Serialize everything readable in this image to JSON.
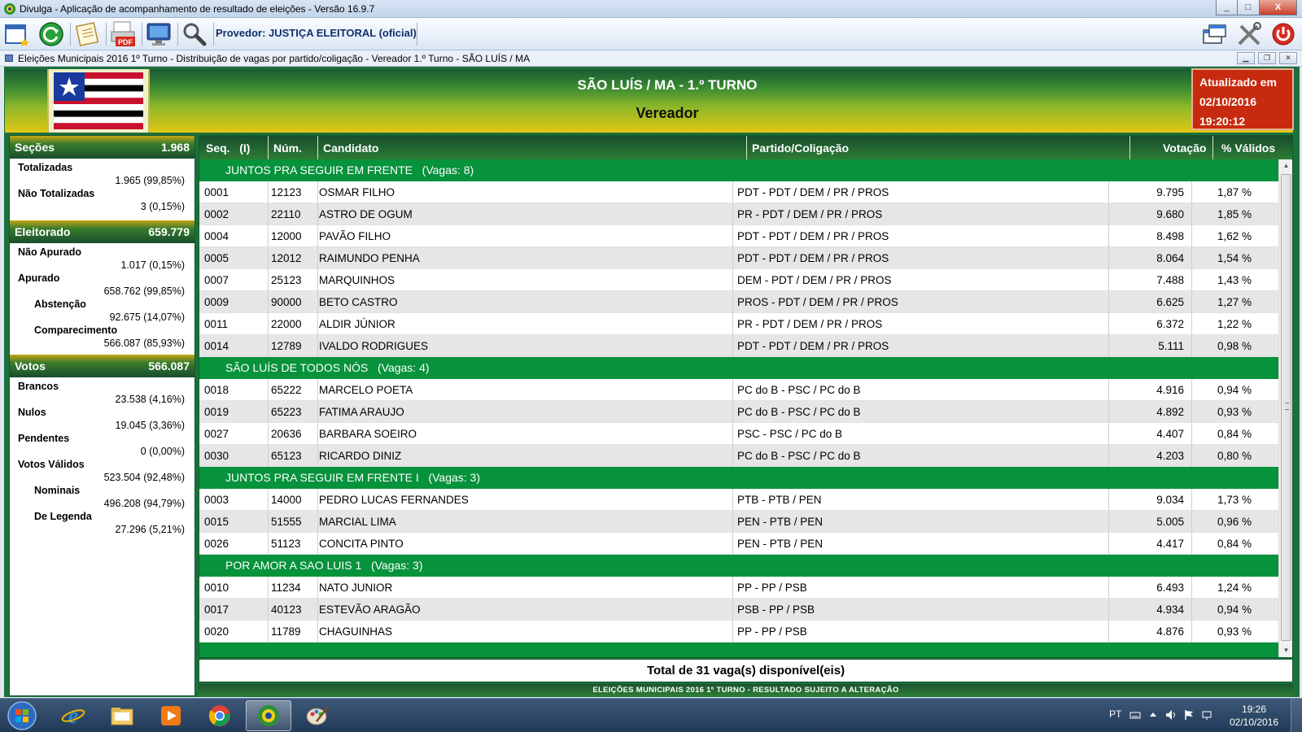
{
  "window": {
    "title": "Divulga - Aplicação de acompanhamento de resultado de eleições - Versão 16.9.7",
    "controls": [
      "_",
      "□",
      "X"
    ]
  },
  "toolbar": {
    "provider_label": "Provedor: JUSTIÇA ELEITORAL (oficial)",
    "buttons": [
      "new-window-icon",
      "refresh-icon",
      "document-icon",
      "pdf-icon",
      "monitor-icon",
      "search-icon"
    ],
    "pdf_label": "PDF"
  },
  "mdi": {
    "title": "Eleições Municipais 2016 1º Turno - Distribuição de vagas por partido/coligação - Vereador 1.º Turno - SÃO LUÍS / MA"
  },
  "header": {
    "title": "SÃO LUÍS / MA - 1.º TURNO",
    "subtitle": "Vereador",
    "updated_label": "Atualizado em",
    "updated_date": "02/10/2016",
    "updated_time": "19:20:12"
  },
  "stats": {
    "secoes": {
      "label": "Seções",
      "value": "1.968"
    },
    "totalizadas": {
      "label": "Totalizadas",
      "value": "1.965 (99,85%)"
    },
    "nao_totalizadas": {
      "label": "Não Totalizadas",
      "value": "3 (0,15%)"
    },
    "eleitorado": {
      "label": "Eleitorado",
      "value": "659.779"
    },
    "nao_apurado": {
      "label": "Não Apurado",
      "value": "1.017 (0,15%)"
    },
    "apurado": {
      "label": "Apurado",
      "value": "658.762 (99,85%)"
    },
    "abstencao": {
      "label": "Abstenção",
      "value": "92.675 (14,07%)"
    },
    "comparecimento": {
      "label": "Comparecimento",
      "value": "566.087 (85,93%)"
    },
    "votos": {
      "label": "Votos",
      "value": "566.087"
    },
    "brancos": {
      "label": "Brancos",
      "value": "23.538 (4,16%)"
    },
    "nulos": {
      "label": "Nulos",
      "value": "19.045 (3,36%)"
    },
    "pendentes": {
      "label": "Pendentes",
      "value": "0 (0,00%)"
    },
    "validos": {
      "label": "Votos Válidos",
      "value": "523.504 (92,48%)"
    },
    "nominais": {
      "label": "Nominais",
      "value": "496.208 (94,79%)"
    },
    "legenda": {
      "label": "De Legenda",
      "value": "27.296 (5,21%)"
    }
  },
  "table": {
    "columns": {
      "seq": "Seq.",
      "seq_suffix": "(I)",
      "num": "Núm.",
      "cand": "Candidato",
      "party": "Partido/Coligação",
      "votes": "Votação",
      "pct": "% Válidos"
    },
    "groups": [
      {
        "label": "JUNTOS PRA SEGUIR EM FRENTE   (Vagas: 8)",
        "rows": [
          [
            "0001",
            "12123",
            "OSMAR FILHO",
            "PDT - PDT / DEM / PR / PROS",
            "9.795",
            "1,87 %"
          ],
          [
            "0002",
            "22110",
            "ASTRO DE OGUM",
            "PR - PDT / DEM / PR / PROS",
            "9.680",
            "1,85 %"
          ],
          [
            "0004",
            "12000",
            "PAVÃO FILHO",
            "PDT - PDT / DEM / PR / PROS",
            "8.498",
            "1,62 %"
          ],
          [
            "0005",
            "12012",
            "RAIMUNDO PENHA",
            "PDT - PDT / DEM / PR / PROS",
            "8.064",
            "1,54 %"
          ],
          [
            "0007",
            "25123",
            "MARQUINHOS",
            "DEM - PDT / DEM / PR / PROS",
            "7.488",
            "1,43 %"
          ],
          [
            "0009",
            "90000",
            "BETO CASTRO",
            "PROS - PDT / DEM / PR / PROS",
            "6.625",
            "1,27 %"
          ],
          [
            "0011",
            "22000",
            "ALDIR JÚNIOR",
            "PR - PDT / DEM / PR / PROS",
            "6.372",
            "1,22 %"
          ],
          [
            "0014",
            "12789",
            "IVALDO RODRIGUES",
            "PDT - PDT / DEM / PR / PROS",
            "5.111",
            "0,98 %"
          ]
        ]
      },
      {
        "label": "SÃO LUÍS DE TODOS NÓS   (Vagas: 4)",
        "rows": [
          [
            "0018",
            "65222",
            "MARCELO POETA",
            "PC do B - PSC / PC do B",
            "4.916",
            "0,94 %"
          ],
          [
            "0019",
            "65223",
            "FATIMA ARAUJO",
            "PC do B - PSC / PC do B",
            "4.892",
            "0,93 %"
          ],
          [
            "0027",
            "20636",
            "BARBARA SOEIRO",
            "PSC - PSC / PC do B",
            "4.407",
            "0,84 %"
          ],
          [
            "0030",
            "65123",
            "RICARDO DINIZ",
            "PC do B - PSC / PC do B",
            "4.203",
            "0,80 %"
          ]
        ]
      },
      {
        "label": "JUNTOS PRA SEGUIR EM FRENTE I   (Vagas: 3)",
        "rows": [
          [
            "0003",
            "14000",
            "PEDRO LUCAS FERNANDES",
            "PTB - PTB / PEN",
            "9.034",
            "1,73 %"
          ],
          [
            "0015",
            "51555",
            "MARCIAL LIMA",
            "PEN - PTB / PEN",
            "5.005",
            "0,96 %"
          ],
          [
            "0026",
            "51123",
            "CONCITA PINTO",
            "PEN - PTB / PEN",
            "4.417",
            "0,84 %"
          ]
        ]
      },
      {
        "label": "POR AMOR A SAO LUIS 1   (Vagas: 3)",
        "rows": [
          [
            "0010",
            "11234",
            "NATO JUNIOR",
            "PP - PP / PSB",
            "6.493",
            "1,24 %"
          ],
          [
            "0017",
            "40123",
            "ESTEVÃO ARAGÃO",
            "PSB - PP / PSB",
            "4.934",
            "0,94 %"
          ],
          [
            "0020",
            "11789",
            "CHAGUINHAS",
            "PP - PP / PSB",
            "4.876",
            "0,93 %"
          ]
        ]
      }
    ],
    "total": "Total de 31 vaga(s) disponível(eis)"
  },
  "footer": "ELEIÇÕES MUNICIPAIS 2016 1º TURNO - RESULTADO SUJEITO A ALTERAÇÃO",
  "taskbar": {
    "lang": "PT",
    "time": "19:26",
    "date": "02/10/2016"
  },
  "colors": {
    "group_green": "#07923c",
    "header_green": "#174c2e",
    "updated_red": "#c72a0e"
  }
}
